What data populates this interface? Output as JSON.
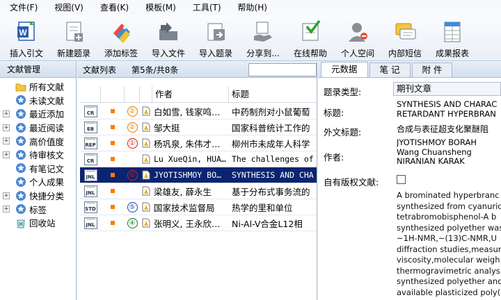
{
  "menu": [
    "文件(F)",
    "视图(V)",
    "查看(K)",
    "模板(M)",
    "工具(T)",
    "帮助(H)"
  ],
  "toolbar": [
    {
      "label": "插入引文",
      "icon": "word-insert-icon"
    },
    {
      "label": "新建题录",
      "icon": "new-record-icon"
    },
    {
      "label": "添加标签",
      "icon": "tag-icon"
    },
    {
      "label": "导入文件",
      "icon": "import-file-icon"
    },
    {
      "label": "导入题录",
      "icon": "import-record-icon"
    },
    {
      "label": "分享到...",
      "icon": "share-icon"
    },
    {
      "label": "在线帮助",
      "icon": "help-check-icon"
    },
    {
      "label": "个人空间",
      "icon": "user-space-icon"
    },
    {
      "label": "内部短信",
      "icon": "message-icon"
    },
    {
      "label": "成果报表",
      "icon": "report-icon"
    }
  ],
  "left": {
    "title": "文献管理",
    "items": [
      {
        "label": "所有文献",
        "icon": "folder-icon",
        "expand": ""
      },
      {
        "label": "未读文献",
        "icon": "star-icon",
        "expand": ""
      },
      {
        "label": "最近添加",
        "icon": "star-icon",
        "expand": "+"
      },
      {
        "label": "最近阅读",
        "icon": "star-icon",
        "expand": "+"
      },
      {
        "label": "高价值度",
        "icon": "star-icon",
        "expand": "+"
      },
      {
        "label": "待审核文",
        "icon": "star-icon",
        "expand": "+"
      },
      {
        "label": "有笔记文",
        "icon": "star-icon",
        "expand": ""
      },
      {
        "label": "个人成果",
        "icon": "star-icon",
        "expand": ""
      },
      {
        "label": "快捷分类",
        "icon": "star-icon",
        "expand": "+"
      },
      {
        "label": "标签",
        "icon": "star-icon",
        "expand": "+"
      },
      {
        "label": "回收站",
        "icon": "recycle-icon",
        "expand": ""
      }
    ]
  },
  "list": {
    "title": "文献列表",
    "count": "第5条/共8条",
    "search_value": "",
    "col_author": "作者",
    "col_title": "标题",
    "rows": [
      {
        "type": "CR",
        "num": "②",
        "author": "白如雪, 钱家鸣…",
        "title": "中药制剂对小鼠葡萄",
        "mono": false,
        "sel": false
      },
      {
        "type": "EB",
        "num": "②",
        "author": "邹大挺",
        "title": "国家科普统计工作的",
        "mono": false,
        "sel": false
      },
      {
        "type": "REP",
        "num": "①",
        "author": "杨巩泉, 朱伟才…",
        "title": "柳州市未成年人科学",
        "mono": false,
        "sel": false
      },
      {
        "type": "CR",
        "num": "",
        "author": "Lu XueQin, HUA…",
        "title": "The challenges of",
        "mono": true,
        "sel": false
      },
      {
        "type": "JNL",
        "num": "①",
        "author": "JYOTISHMOY BO…",
        "title": "SYNTHESIS AND CHA",
        "mono": true,
        "sel": true
      },
      {
        "type": "JNL",
        "num": "",
        "author": "梁雄友, 薛永生",
        "title": "基于分布式事务流的",
        "mono": false,
        "sel": false
      },
      {
        "type": "STD",
        "num": "⑤",
        "author": "国家技术监督局",
        "title": "热学的里和单位",
        "mono": false,
        "sel": false
      },
      {
        "type": "JNL",
        "num": "④",
        "author": "张明义, 王永欣…",
        "title": "Ni-Al-V合金L12相",
        "mono": false,
        "sel": false
      }
    ]
  },
  "detail": {
    "tabs": [
      "元数据",
      "笔 记",
      "附 件"
    ],
    "type_label": "题录类型:",
    "type_value": "期刊文章",
    "title_label": "标题:",
    "title_value": [
      "SYNTHESIS AND CHARAC",
      "RETARDANT HYPERBRAN"
    ],
    "foreign_title_label": "外文标题:",
    "foreign_title_value": "合成与表征超支化聚醚阻",
    "author_label": "作者:",
    "author_value": [
      "JYOTISHMOY BORAH",
      "Wang Chuansheng",
      "NIRANIAN KARAK"
    ],
    "copyright_label": "自有版权文献:",
    "abstract": [
      "A brominated hyperbranc",
      "synthesized from cyanuric",
      "tetrabromobisphenol-A b",
      "synthesized polyether was",
      "~1H-NMR,~(13)C-NMR,U",
      "diffraction studies,measur",
      "viscosity,molecular weigh",
      "thermogravimetric analys",
      "synthesized polyether and",
      "available plasticized poly("
    ]
  }
}
